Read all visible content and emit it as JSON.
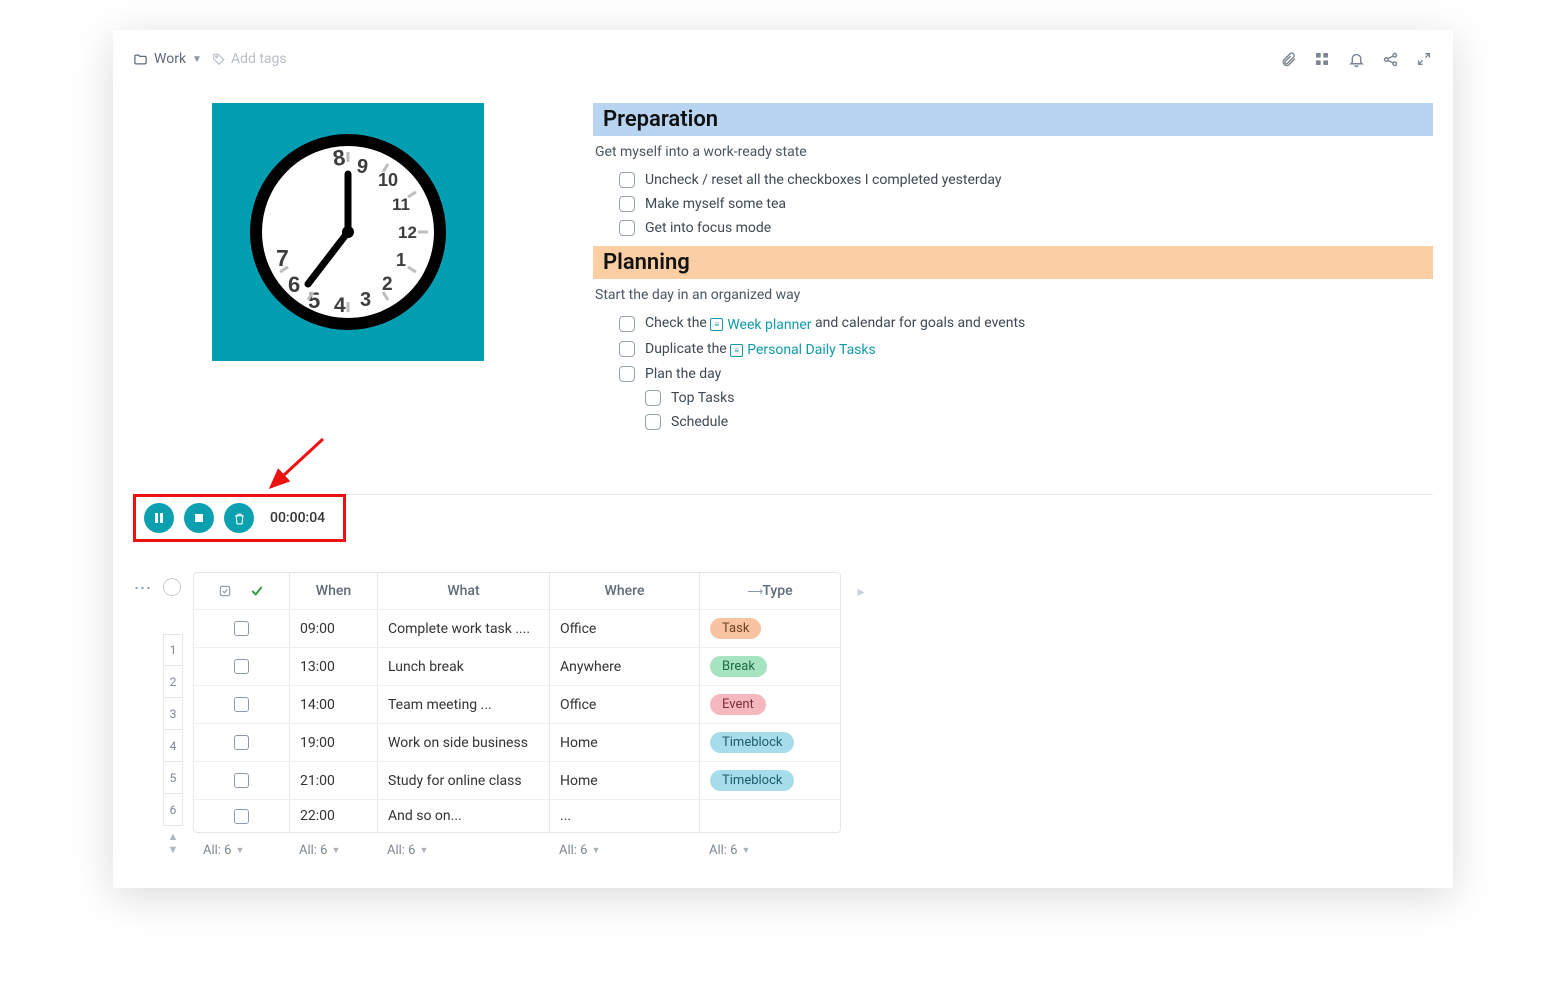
{
  "topbar": {
    "folder_label": "Work",
    "addtags_label": "Add tags"
  },
  "sections": {
    "preparation": {
      "title": "Preparation",
      "subtitle": "Get myself into a work-ready state",
      "items": [
        "Uncheck / reset all the checkboxes I completed yesterday",
        "Make myself some tea",
        "Get into focus mode"
      ]
    },
    "planning": {
      "title": "Planning",
      "subtitle": "Start the day in an organized way",
      "item0_pre": "Check the",
      "item0_link": "Week planner",
      "item0_post": "and calendar for goals and events",
      "item1_pre": "Duplicate the",
      "item1_link": "Personal Daily Tasks",
      "item2": "Plan the day",
      "item2_sub1": "Top Tasks",
      "item2_sub2": "Schedule"
    }
  },
  "timer": {
    "display": "00:00:04"
  },
  "table": {
    "headers": {
      "when": "When",
      "what": "What",
      "where": "Where",
      "type": "Type"
    },
    "rows": [
      {
        "idx": "1",
        "when": "09:00",
        "what": "Complete work task ....",
        "where": "Office",
        "type": "Task",
        "pill": "pill-task"
      },
      {
        "idx": "2",
        "when": "13:00",
        "what": "Lunch break",
        "where": "Anywhere",
        "type": "Break",
        "pill": "pill-break"
      },
      {
        "idx": "3",
        "when": "14:00",
        "what": "Team meeting ...",
        "where": "Office",
        "type": "Event",
        "pill": "pill-event"
      },
      {
        "idx": "4",
        "when": "19:00",
        "what": "Work on side business",
        "where": "Home",
        "type": "Timeblock",
        "pill": "pill-timeblock"
      },
      {
        "idx": "5",
        "when": "21:00",
        "what": "Study for online class",
        "where": "Home",
        "type": "Timeblock",
        "pill": "pill-timeblock"
      },
      {
        "idx": "6",
        "when": "22:00",
        "what": "And so on...",
        "where": "...",
        "type": "",
        "pill": ""
      }
    ],
    "footer_label": "All: 6"
  }
}
